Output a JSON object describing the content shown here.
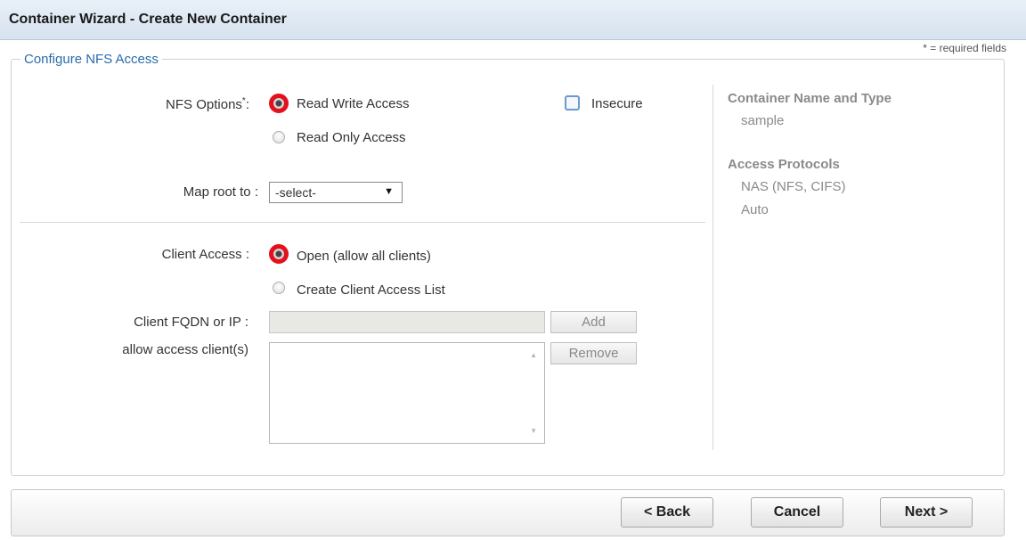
{
  "window": {
    "title": "Container Wizard - Create New Container"
  },
  "required_note": "* = required fields",
  "section_title": "Configure NFS Access",
  "nfs_options": {
    "label": "NFS Options",
    "required_mark": "*",
    "label_suffix": ":",
    "options": [
      {
        "label": "Read Write Access",
        "selected": true
      },
      {
        "label": "Read Only Access",
        "selected": false
      }
    ],
    "insecure": {
      "label": "Insecure",
      "checked": false
    }
  },
  "map_root": {
    "label": "Map root to :",
    "selected": "-select-"
  },
  "client_access": {
    "label": "Client Access :",
    "options": [
      {
        "label": "Open (allow all clients)",
        "selected": true
      },
      {
        "label": "Create Client Access List",
        "selected": false
      }
    ],
    "fqdn_label": "Client FQDN or IP :",
    "fqdn_value": "",
    "add_label": "Add",
    "list_label": "allow access client(s)",
    "clients": [],
    "remove_label": "Remove"
  },
  "summary": {
    "container_heading": "Container Name and Type",
    "container_value": "sample",
    "protocols_heading": "Access Protocols",
    "protocols": [
      "NAS (NFS, CIFS)",
      "Auto"
    ]
  },
  "footer": {
    "back_label": "< Back",
    "cancel_label": "Cancel",
    "next_label": "Next >"
  },
  "colors": {
    "selected_radio_ring": "#e4101c",
    "section_title": "#2a6cab",
    "titlebar": "#d6e2ef"
  }
}
